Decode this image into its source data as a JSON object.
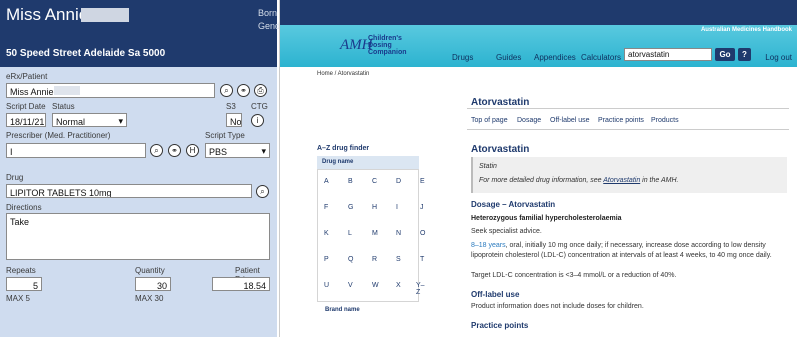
{
  "left": {
    "patient_name": "Miss Annie",
    "born_label": "Born",
    "gender_label": "Gende",
    "address": "50 Speed Street Adelaide Sa 5000",
    "ehr_label": "eRx/Patient",
    "patient_field": "Miss Annie",
    "script_date_label": "Script Date",
    "script_date": "18/11/21",
    "status_label": "Status",
    "status_value": "Normal",
    "s3_label": "S3",
    "s3_value": "No",
    "ctg_label": "CTG",
    "ctg_icon": "i",
    "prescriber_label": "Prescriber (Med. Practitioner)",
    "prescriber_value": "I",
    "script_type_label": "Script Type",
    "script_type_value": "PBS",
    "drug_label": "Drug",
    "drug_value": "LIPITOR TABLETS 10mg",
    "directions_label": "Directions",
    "directions_value": "Take",
    "repeats_label": "Repeats",
    "repeats_value": "5",
    "quantity_label": "Quantity",
    "quantity_value": "30",
    "price_label": "Patient Price",
    "price_value": "18.54",
    "max_repeats": "MAX 5",
    "max_quantity": "MAX 30",
    "h_icon": "H"
  },
  "right": {
    "amh_label": "Australian Medicines Handbook",
    "logo_mark": "AMH",
    "logo_line1": "Children's",
    "logo_line2": "Dosing",
    "logo_line3": "Companion",
    "nav": [
      "Drugs",
      "Guides",
      "Appendices",
      "Calculators"
    ],
    "search_value": "atorvastatin",
    "go_label": "Go",
    "help_label": "?",
    "logout_label": "Log out",
    "breadcrumb": "Home / Atorvastatin",
    "drug_heading": "Atorvastatin",
    "tabs": [
      "Top of page",
      "Dosage",
      "Off-label use",
      "Practice points",
      "Products"
    ],
    "az_title": "A–Z drug finder",
    "az_drug_name": "Drug name",
    "az_letters": [
      "A",
      "B",
      "C",
      "D",
      "E",
      "F",
      "G",
      "H",
      "I",
      "J",
      "K",
      "L",
      "M",
      "N",
      "O",
      "P",
      "Q",
      "R",
      "S",
      "T",
      "U",
      "V",
      "W",
      "X",
      "Y–Z"
    ],
    "brand_name": "Brand name",
    "main_title": "Atorvastatin",
    "statin_class": "Statin",
    "statin_more_prefix": "For more detailed drug information, see ",
    "statin_link": "Atorvastatin",
    "statin_more_suffix": " in the AMH.",
    "dosage_heading": "Dosage – Atorvastatin",
    "indication": "Heterozygous familial hypercholesterolaemia",
    "advice": "Seek specialist advice.",
    "dose_age": "8–18 years",
    "dose_rest": ", oral, initially 10 mg once daily; if necessary, increase dose according to low density lipoprotein cholesterol (LDL-C) concentration at intervals of at least 4 weeks, to 40 mg once daily.",
    "target": "Target LDL-C concentration is <3–4 mmol/L or a reduction of 40%.",
    "offlabel_heading": "Off-label use",
    "offlabel_text": "Product information does not include doses for children.",
    "practice_heading": "Practice points"
  },
  "colors": {
    "header_navy": "#1f3a6d",
    "panel_blue": "#cfdcef",
    "nav_teal": "#2cb3d0"
  }
}
